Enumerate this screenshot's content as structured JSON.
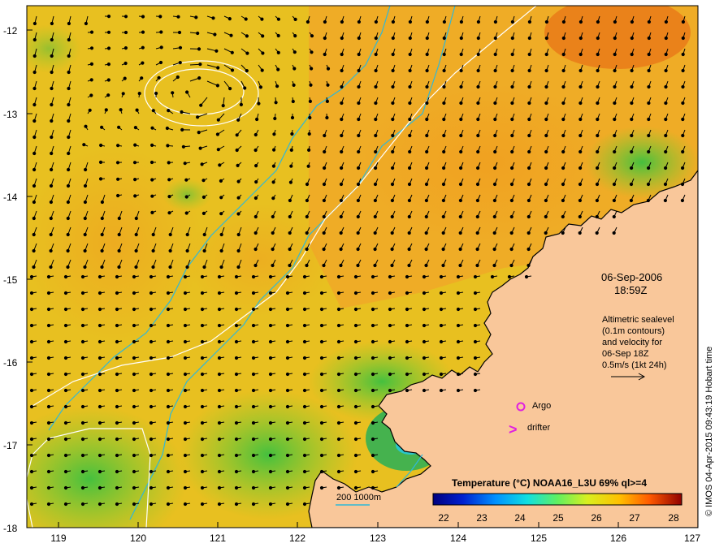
{
  "map": {
    "y_ticks": [
      "-12",
      "-13",
      "-14",
      "-15",
      "-16",
      "-17",
      "-18"
    ],
    "x_ticks": [
      "119",
      "120",
      "121",
      "122",
      "123",
      "124",
      "125",
      "126",
      "127"
    ],
    "date": "06-Sep-2006",
    "time": "18:59Z",
    "info_lines": [
      "Altimetric sealevel",
      "(0.1m contours)",
      "and velocity for",
      "06-Sep 18Z",
      "0.5m/s (1kt 24h)"
    ],
    "argo_label": "Argo",
    "drifter_symbol": ">",
    "drifter_label": "drifter",
    "depth_legend": "200  1000m",
    "colorbar_title": "Temperature (°C) NOAA16_L3U 69% ql>=4",
    "colorbar_ticks": [
      "22",
      "23",
      "24",
      "25",
      "26",
      "27",
      "28"
    ],
    "credit": "© IMOS 04-Apr-2015 09:43:19 Hobart time",
    "colors": {
      "ocean_warm": "#f5a623",
      "ocean_mid": "#e8d21e",
      "ocean_cool": "#7ccf2a",
      "land": "#f9c79a",
      "isobath": "#2fb8d8",
      "sealevel_contour": "#ffffff",
      "marker": "#e020e0"
    }
  }
}
